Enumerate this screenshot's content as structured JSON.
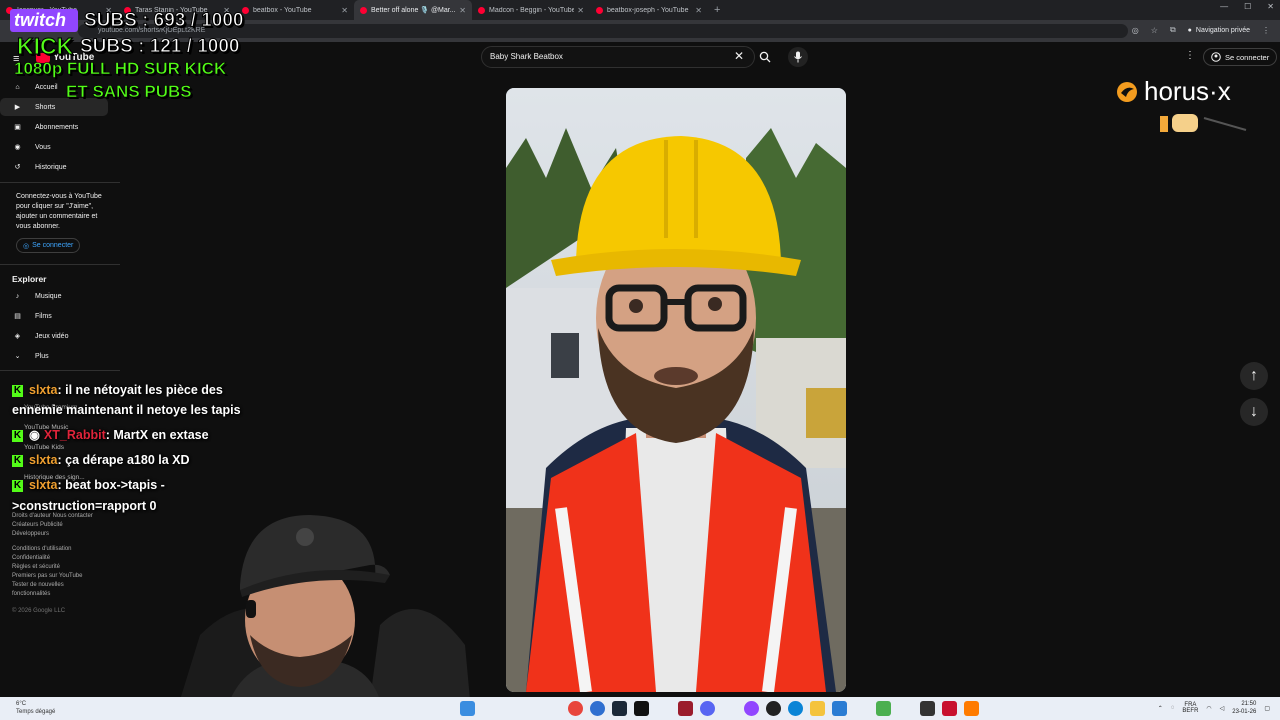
{
  "browser": {
    "tabs": [
      {
        "title": "Icespyer - YouTube",
        "active": false
      },
      {
        "title": "Taras Stanin - YouTube",
        "active": false
      },
      {
        "title": "beatbox - YouTube",
        "active": false
      },
      {
        "title": "Better off alone 🎙️ @Mar...",
        "active": true
      },
      {
        "title": "Madcon - Beggin - YouTube",
        "active": false
      },
      {
        "title": "beatbox-joseph - YouTube",
        "active": false
      }
    ],
    "new_tab": "+",
    "url": "youtube.com/shorts/KjOEpLt2KRE",
    "private_label": "Navigation privée"
  },
  "youtube": {
    "logo_text": "YouTube",
    "search_value": "Baby Shark Beatbox",
    "signin_label": "Se connecter",
    "sidebar": {
      "main": [
        {
          "label": "Accueil",
          "icon": "home-icon"
        },
        {
          "label": "Shorts",
          "icon": "shorts-icon",
          "selected": true
        },
        {
          "label": "Abonnements",
          "icon": "subscriptions-icon"
        },
        {
          "label": "Vous",
          "icon": "you-icon"
        },
        {
          "label": "Historique",
          "icon": "history-icon"
        }
      ],
      "signin_promo": "Connectez-vous à YouTube pour cliquer sur \"J'aime\", ajouter un commentaire et vous abonner.",
      "signin_button": "Se connecter",
      "explore_heading": "Explorer",
      "explore": [
        {
          "label": "Musique",
          "icon": "music-icon"
        },
        {
          "label": "Films",
          "icon": "films-icon"
        },
        {
          "label": "Jeux vidéo",
          "icon": "gaming-icon"
        },
        {
          "label": "Plus",
          "icon": "chevron-down-icon"
        }
      ],
      "more_from": [
        "YouTube Premium",
        "YouTube Music",
        "YouTube Kids",
        "Historique des sign..."
      ],
      "footer_1": "Droits d'auteur  Nous contacter\nCréateurs  Publicité\nDéveloppeurs",
      "footer_2": "Conditions d'utilisation\nConfidentialité\nRègles et sécurité\nPremiers pas sur YouTube\nTester de nouvelles\nfonctionnalités",
      "copyright": "© 2026 Google LLC"
    }
  },
  "overlay": {
    "twitch_label": "twitch",
    "twitch_subs": "SUBS : 693 / 1000",
    "kick_label": "KICK",
    "kick_subs": "SUBS : 121 / 1000",
    "promo_line1": "1080p FULL HD SUR KICK",
    "promo_line2": "ET SANS PUBS",
    "horus_logo": "horus·x"
  },
  "chat": [
    {
      "user": "slxta",
      "color": "orange",
      "line1": ": il ne nétoyait les pièce des",
      "line2": "ennemie maintenant il netoye les tapis"
    },
    {
      "user": "XT_Rabbit",
      "color": "red",
      "line1": ": MartX en extase",
      "line2": ""
    },
    {
      "user": "slxta",
      "color": "orange",
      "line1": ": ça dérape a180 la XD",
      "line2": ""
    },
    {
      "user": "slxta",
      "color": "orange",
      "line1": ": beat box->tapis -",
      "line2": ">construction=rapport 0"
    }
  ],
  "taskbar": {
    "weather_temp": "6°C",
    "weather_desc": "Temps dégagé",
    "lang": "FRA\nBEFR",
    "time": "21:50",
    "date": "23-01-26"
  },
  "colors": {
    "yt_red": "#ff0033",
    "twitch_purple": "#9146ff",
    "kick_green": "#53fc18"
  }
}
